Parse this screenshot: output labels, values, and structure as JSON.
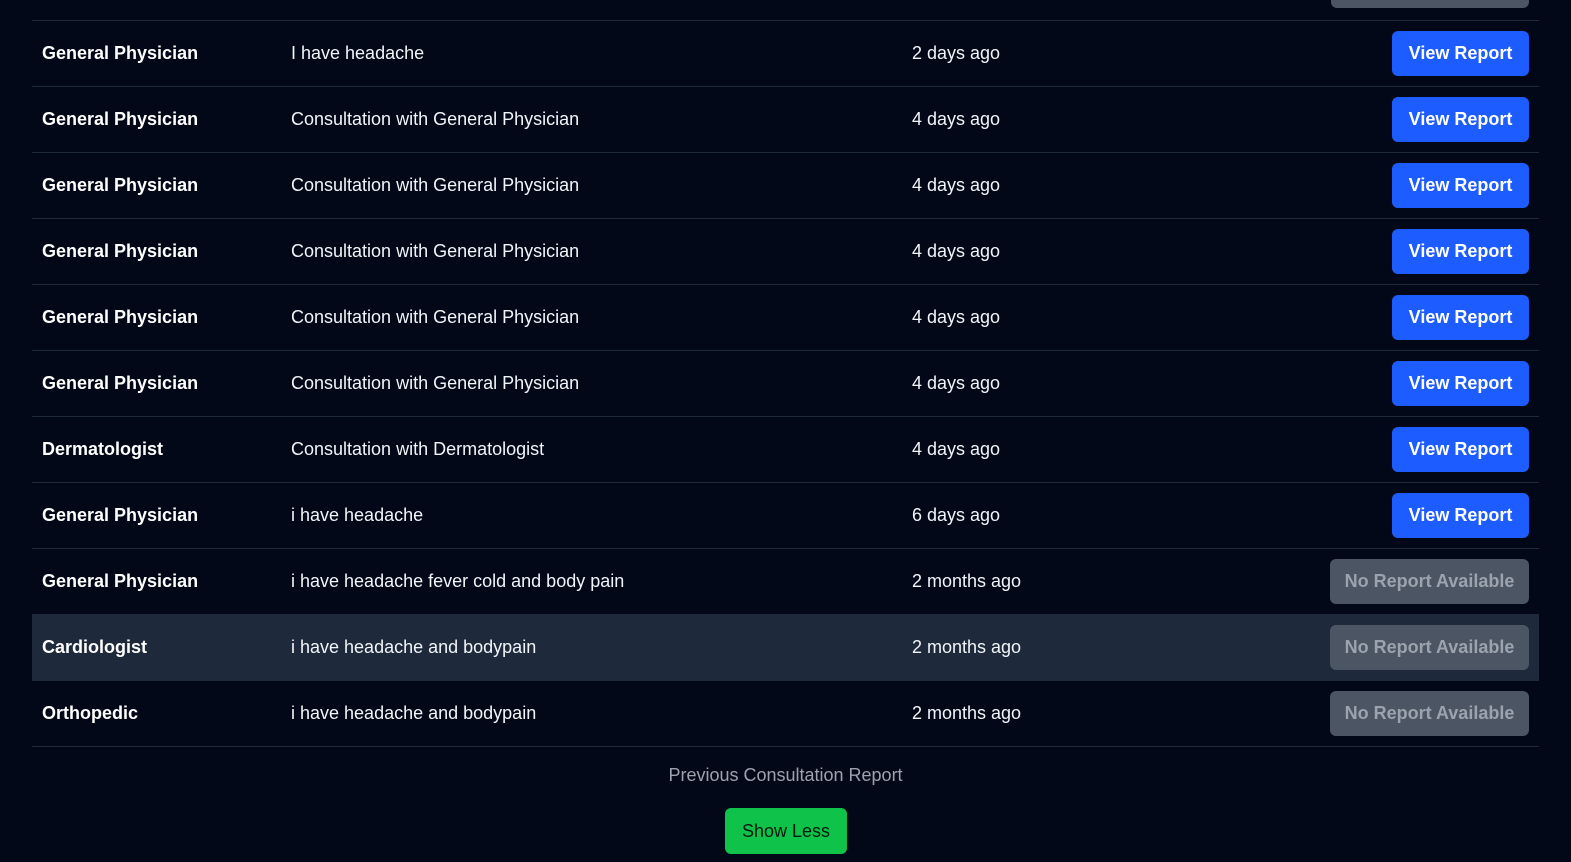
{
  "consultations": {
    "rows": [
      {
        "specialist": "General Physician",
        "reason": "I have headache",
        "time": "2 days ago",
        "action": "View Report",
        "has_report": true
      },
      {
        "specialist": "General Physician",
        "reason": "Consultation with General Physician",
        "time": "4 days ago",
        "action": "View Report",
        "has_report": true
      },
      {
        "specialist": "General Physician",
        "reason": "Consultation with General Physician",
        "time": "4 days ago",
        "action": "View Report",
        "has_report": true
      },
      {
        "specialist": "General Physician",
        "reason": "Consultation with General Physician",
        "time": "4 days ago",
        "action": "View Report",
        "has_report": true
      },
      {
        "specialist": "General Physician",
        "reason": "Consultation with General Physician",
        "time": "4 days ago",
        "action": "View Report",
        "has_report": true
      },
      {
        "specialist": "General Physician",
        "reason": "Consultation with General Physician",
        "time": "4 days ago",
        "action": "View Report",
        "has_report": true
      },
      {
        "specialist": "Dermatologist",
        "reason": "Consultation with Dermatologist",
        "time": "4 days ago",
        "action": "View Report",
        "has_report": true
      },
      {
        "specialist": "General Physician",
        "reason": "i have headache",
        "time": "6 days ago",
        "action": "View Report",
        "has_report": true
      },
      {
        "specialist": "General Physician",
        "reason": "i have headache fever cold and body pain",
        "time": "2 months ago",
        "action": "No Report Available",
        "has_report": false
      },
      {
        "specialist": "Cardiologist",
        "reason": "i have headache and bodypain",
        "time": "2 months ago",
        "action": "No Report Available",
        "has_report": false,
        "hovered": true
      },
      {
        "specialist": "Orthopedic",
        "reason": "i have headache and bodypain",
        "time": "2 months ago",
        "action": "No Report Available",
        "has_report": false
      }
    ]
  },
  "footer": {
    "caption": "Previous Consultation Report",
    "toggle_label": "Show Less"
  },
  "colors": {
    "background": "#020817",
    "primary_button": "#1d5cff",
    "disabled_button": "#4b5563",
    "show_less_button": "#0fc34a",
    "hover_row": "#1e293b"
  }
}
